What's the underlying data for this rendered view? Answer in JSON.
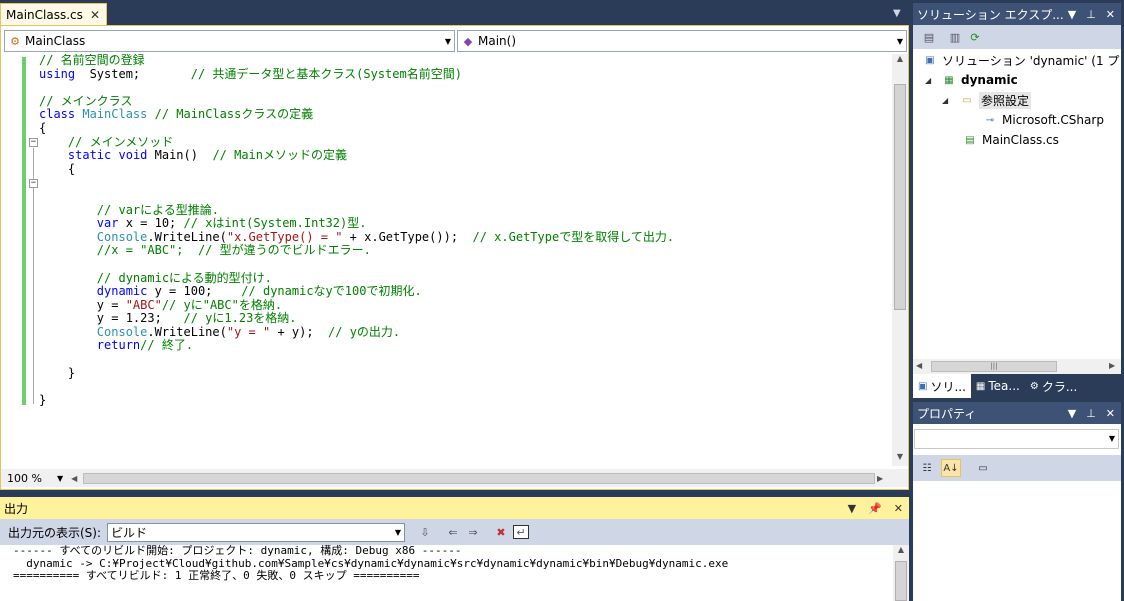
{
  "editor": {
    "tab_label": "MainClass.cs",
    "tab_close": "✕",
    "nav_left": "MainClass",
    "nav_right": "Main()",
    "zoom": "100 %",
    "code_lines": [
      [
        [
          "cm",
          "// 名前空間の登録"
        ]
      ],
      [
        [
          "kw",
          "using"
        ],
        [
          "",
          "  System;       "
        ],
        [
          "cm",
          "// 共通データ型と基本クラス(System名前空間)"
        ]
      ],
      [
        [
          "",
          ""
        ]
      ],
      [
        [
          "cm",
          "// メインクラス"
        ]
      ],
      [
        [
          "kw",
          "class"
        ],
        [
          "",
          " "
        ],
        [
          "ty",
          "MainClass"
        ],
        [
          "",
          " "
        ],
        [
          "cm",
          "// MainClassクラスの定義"
        ]
      ],
      [
        [
          "",
          "{"
        ]
      ],
      [
        [
          "",
          "    "
        ],
        [
          "cm",
          "// メインメソッド"
        ]
      ],
      [
        [
          "",
          "    "
        ],
        [
          "kw",
          "static"
        ],
        [
          "",
          " "
        ],
        [
          "kw",
          "void"
        ],
        [
          "",
          " Main()  "
        ],
        [
          "cm",
          "// Mainメソッドの定義"
        ]
      ],
      [
        [
          "",
          "    {"
        ]
      ],
      [
        [
          "",
          ""
        ]
      ],
      [
        [
          "",
          ""
        ]
      ],
      [
        [
          "",
          "        "
        ],
        [
          "cm",
          "// varによる型推論."
        ]
      ],
      [
        [
          "",
          "        "
        ],
        [
          "kw",
          "var"
        ],
        [
          "",
          " x = 10; "
        ],
        [
          "cm",
          "// xはint(System.Int32)型."
        ]
      ],
      [
        [
          "",
          "        "
        ],
        [
          "ty",
          "Console"
        ],
        [
          "",
          ".WriteLine("
        ],
        [
          "st",
          "\"x.GetType() = \""
        ],
        [
          "",
          " + x.GetType());  "
        ],
        [
          "cm",
          "// x.GetTypeで型を取得して出力."
        ]
      ],
      [
        [
          "",
          "        "
        ],
        [
          "cm",
          "//x = \"ABC\";  // 型が違うのでビルドエラー."
        ]
      ],
      [
        [
          "",
          ""
        ]
      ],
      [
        [
          "",
          "        "
        ],
        [
          "cm",
          "// dynamicによる動的型付け."
        ]
      ],
      [
        [
          "",
          "        "
        ],
        [
          "kw",
          "dynamic"
        ],
        [
          "",
          " y = 100;    "
        ],
        [
          "cm",
          "// dynamicなyで100で初期化."
        ]
      ],
      [
        [
          "",
          "        y = "
        ],
        [
          "st",
          "\"ABC\""
        ],
        [
          ";  "
        ],
        [
          "cm",
          "// yに\"ABC\"を格納."
        ]
      ],
      [
        [
          "",
          "        y = 1.23;   "
        ],
        [
          "cm",
          "// yに1.23を格納."
        ]
      ],
      [
        [
          "",
          "        "
        ],
        [
          "ty",
          "Console"
        ],
        [
          "",
          ".WriteLine("
        ],
        [
          "st",
          "\"y = \""
        ],
        [
          "",
          " + y);  "
        ],
        [
          "cm",
          "// yの出力."
        ]
      ],
      [
        [
          "",
          "        "
        ],
        [
          "kw",
          "return"
        ],
        [
          ";"
        ],
        [
          " "
        ],
        [
          "cm",
          "// 終了."
        ]
      ],
      [
        [
          "",
          ""
        ]
      ],
      [
        [
          "",
          "    }"
        ]
      ],
      [
        [
          "",
          ""
        ]
      ],
      [
        [
          "",
          "}"
        ]
      ]
    ]
  },
  "output": {
    "title": "出力",
    "source_label": "出力元の表示(S):",
    "source_value": "ビルド",
    "lines": [
      "------ すべてのリビルド開始: プロジェクト: dynamic, 構成: Debug x86 ------",
      "  dynamic -> C:¥Project¥Cloud¥github.com¥Sample¥cs¥dynamic¥dynamic¥src¥dynamic¥dynamic¥bin¥Debug¥dynamic.exe",
      "========== すべてリビルド: 1 正常終了、0 失敗、0 スキップ =========="
    ]
  },
  "solution": {
    "title": "ソリューション エクスプ...",
    "root": "ソリューション 'dynamic' (1 プ",
    "project": "dynamic",
    "refs": "参照設定",
    "ref_item": "Microsoft.CSharp",
    "file": "MainClass.cs",
    "tabs": [
      "ソリ...",
      "Tea...",
      "クラ..."
    ]
  },
  "properties": {
    "title": "プロパティ"
  },
  "colors": {
    "keyword": "#0000ff",
    "comment": "#008000",
    "type": "#2b91af",
    "string": "#a31515",
    "active_pane_title": "#fff29d",
    "background": "#2b3c59"
  }
}
